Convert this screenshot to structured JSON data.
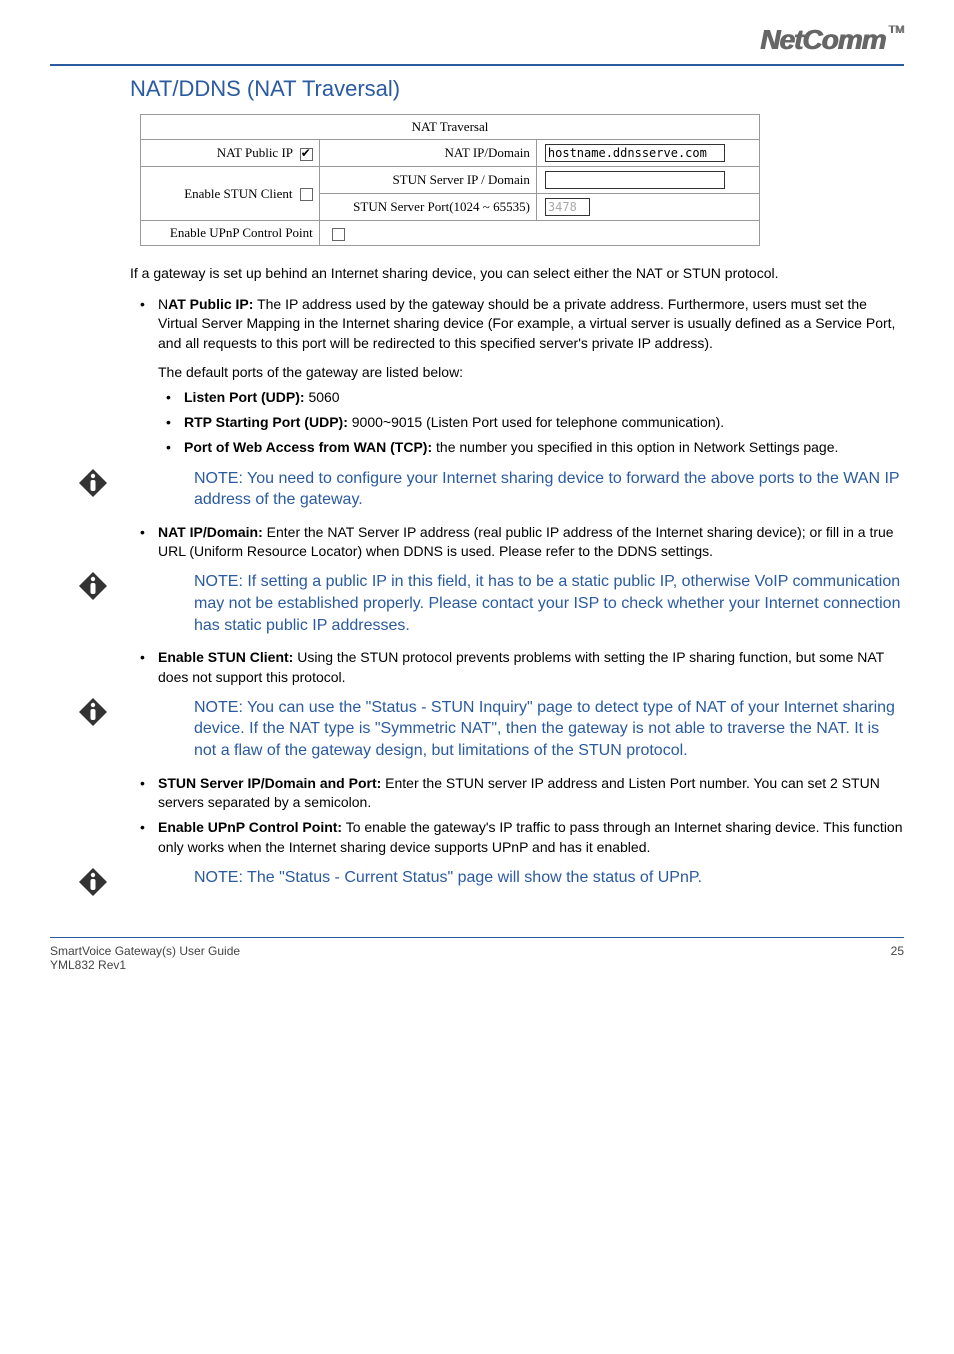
{
  "brand": {
    "name": "NetComm",
    "tm": "TM"
  },
  "heading": "NAT/DDNS (NAT Traversal)",
  "table": {
    "title": "NAT Traversal",
    "nat_public_ip_label": "NAT Public IP",
    "nat_public_ip_checked": true,
    "nat_ip_domain_label": "NAT IP/Domain",
    "nat_ip_domain_value": "hostname.ddnsserve.com",
    "enable_stun_label": "Enable STUN Client",
    "enable_stun_checked": false,
    "stun_server_ip_label": "STUN Server IP / Domain",
    "stun_server_ip_value": "",
    "stun_server_port_label": "STUN Server Port(1024 ~ 65535)",
    "stun_server_port_value": "3478",
    "enable_upnp_label": "Enable UPnP Control Point",
    "enable_upnp_checked": false
  },
  "intro": "If a gateway is set up behind an Internet sharing device, you can select either the NAT or STUN protocol.",
  "bullets1": {
    "nat_public_ip_prefix": "N",
    "nat_public_ip_bold": "AT Public IP:",
    "nat_public_ip_text": " The IP address used by the gateway should be a private address. Furthermore, users must set the Virtual Server Mapping in the Internet sharing device (For example, a virtual server is usually defined as a Service Port, and all requests to this port will be redirected to this specified server's private IP address)."
  },
  "default_ports_intro": "The default ports of the gateway are listed below:",
  "ports": {
    "listen_bold": "Listen Port (UDP):",
    "listen_val": " 5060",
    "rtp_bold": "RTP Starting Port (UDP):",
    "rtp_val": " 9000~9015 (Listen Port used for telephone communication).",
    "web_bold": "Port of Web Access from WAN (TCP):",
    "web_val": " the number you specified in this option in Network Settings page."
  },
  "note1": "NOTE: You need to configure your Internet sharing device to forward the above ports to the WAN IP address of the gateway.",
  "bullets2": {
    "nat_ip_domain_bold": "NAT IP/Domain:",
    "nat_ip_domain_text": " Enter the NAT Server IP address (real public IP address of the Internet sharing device); or fill in a true URL (Uniform Resource Locator) when DDNS is used. Please refer to the DDNS settings."
  },
  "note2": "NOTE: If setting a public IP in this field, it has to be a static public IP, otherwise VoIP communication may not be established properly. Please contact your ISP to check whether your Internet connection has static public IP addresses.",
  "bullets3": {
    "enable_stun_bold": "Enable STUN Client:",
    "enable_stun_text": " Using the STUN protocol prevents problems with setting the IP sharing function, but some NAT does not support this protocol."
  },
  "note3": "NOTE: You can use the \"Status - STUN Inquiry\" page to detect type of NAT of your Internet sharing device. If the NAT type is \"Symmetric NAT\", then the gateway is not able to traverse the NAT. It is not a flaw of the gateway design, but limitations of the STUN protocol.",
  "bullets4": {
    "stun_server_bold": "STUN Server IP/Domain and Port:",
    "stun_server_text": " Enter the STUN server IP address and Listen Port number. You can set 2 STUN servers separated by a semicolon.",
    "enable_upnp_bold": "Enable UPnP Control Point:",
    "enable_upnp_text": " To enable the gateway's IP traffic to pass through an Internet sharing device. This function only works when the Internet sharing device supports UPnP and has it enabled."
  },
  "note4": "NOTE: The \"Status - Current Status\" page will show the status of UPnP.",
  "footer": {
    "left1": "SmartVoice Gateway(s) User Guide",
    "left2": "YML832 Rev1",
    "page": "25"
  }
}
